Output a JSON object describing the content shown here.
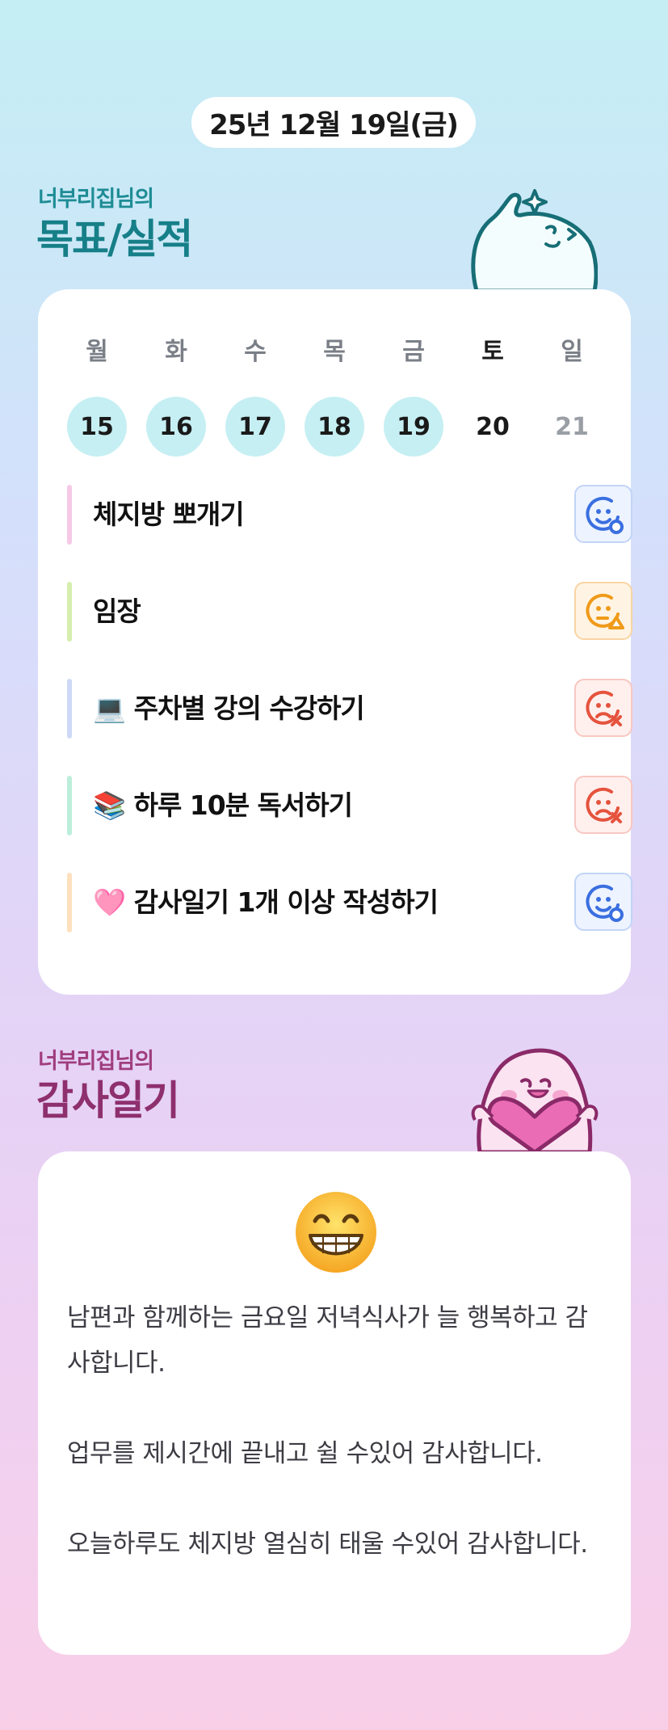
{
  "date": "25년 12월 19일(금)",
  "goals_section": {
    "subtitle": "너부리집님의",
    "title": "목표/실적"
  },
  "week": {
    "days": [
      {
        "dow": "월",
        "num": "15",
        "status": "done"
      },
      {
        "dow": "화",
        "num": "16",
        "status": "done"
      },
      {
        "dow": "수",
        "num": "17",
        "status": "done"
      },
      {
        "dow": "목",
        "num": "18",
        "status": "done"
      },
      {
        "dow": "금",
        "num": "19",
        "status": "done"
      },
      {
        "dow": "토",
        "num": "20",
        "status": "today"
      },
      {
        "dow": "일",
        "num": "21",
        "status": "future"
      }
    ]
  },
  "goals": [
    {
      "label": "체지방 뽀개기",
      "bar_color": "#f5c9e7",
      "status": "achieved",
      "status_icon": "smile-check-icon"
    },
    {
      "label": "임장",
      "bar_color": "#d6efaf",
      "status": "partial",
      "status_icon": "neutral-triangle-icon"
    },
    {
      "label": "💻 주차별 강의 수강하기",
      "bar_color": "#cdd9f6",
      "status": "failed",
      "status_icon": "sad-x-icon"
    },
    {
      "label": "📚 하루 10분 독서하기",
      "bar_color": "#bdeedc",
      "status": "failed",
      "status_icon": "sad-x-icon"
    },
    {
      "label": "🩷 감사일기 1개 이상 작성하기",
      "bar_color": "#fde1bf",
      "status": "achieved",
      "status_icon": "smile-check-icon"
    }
  ],
  "diary_section": {
    "subtitle": "너부리집님의",
    "title": "감사일기"
  },
  "diary": {
    "mood_icon": "grinning-face-icon",
    "entries": [
      "남편과 함께하는 금요일 저녁식사가 늘 행복하고 감사합니다.",
      "업무를 제시간에 끝내고 쉴 수있어 감사합니다.",
      "오늘하루도 체지방 열심히 태울 수있어 감사합니다."
    ]
  },
  "colors": {
    "accent_teal": "#167f88",
    "accent_plum": "#8e2f6e",
    "done_circle": "#c6eff3",
    "status_blue": "#3a6fe0",
    "status_orange": "#f09a1a",
    "status_red": "#e5533d"
  }
}
